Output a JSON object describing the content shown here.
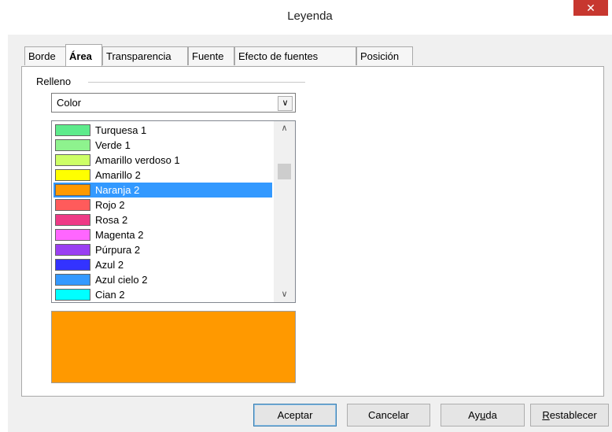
{
  "dialog": {
    "title": "Leyenda",
    "close_glyph": "✕"
  },
  "tabs": [
    {
      "label": "Borde"
    },
    {
      "label": "Área"
    },
    {
      "label": "Transparencia"
    },
    {
      "label": "Fuente"
    },
    {
      "label": "Efecto de fuentes"
    },
    {
      "label": "Posición"
    }
  ],
  "active_tab": "Área",
  "fill": {
    "group_label": "Relleno",
    "type_value": "Color",
    "colors": [
      {
        "name": "Turquesa 1",
        "hex": "#5eeb8c"
      },
      {
        "name": "Verde 1",
        "hex": "#8ef38e"
      },
      {
        "name": "Amarillo verdoso 1",
        "hex": "#cdff66"
      },
      {
        "name": "Amarillo 2",
        "hex": "#ffff00"
      },
      {
        "name": "Naranja 2",
        "hex": "#ff9900"
      },
      {
        "name": "Rojo 2",
        "hex": "#ff5b5b"
      },
      {
        "name": "Rosa 2",
        "hex": "#ee3a86"
      },
      {
        "name": "Magenta 2",
        "hex": "#ff66ff"
      },
      {
        "name": "Púrpura 2",
        "hex": "#9a3ff2"
      },
      {
        "name": "Azul 2",
        "hex": "#3333ff"
      },
      {
        "name": "Azul cielo 2",
        "hex": "#3399ff"
      },
      {
        "name": "Cian 2",
        "hex": "#00ffff"
      }
    ],
    "selected_color": "Naranja 2",
    "preview_color": "#ff9900"
  },
  "buttons": {
    "ok": "Aceptar",
    "cancel": "Cancelar",
    "help": "Ayuda",
    "reset": "Restablecer"
  },
  "colors": {
    "selection": "#3399ff",
    "close_button": "#c7372f"
  }
}
